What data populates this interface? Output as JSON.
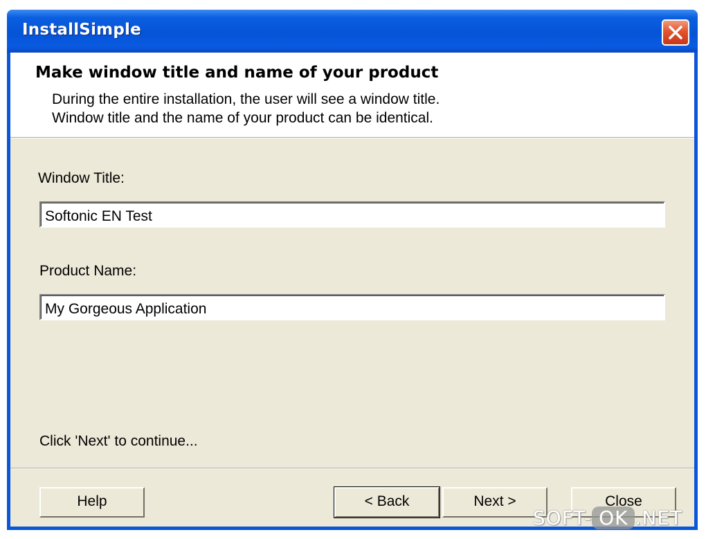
{
  "window": {
    "title": "InstallSimple",
    "close_icon": "close-x-icon"
  },
  "header": {
    "title": "Make window title and name of your product",
    "desc_line1": "During the entire installation, the user will see a window title.",
    "desc_line2": "Window title and the name of your product can be identical."
  },
  "form": {
    "window_title_label": "Window Title:",
    "window_title_value": "Softonic EN Test",
    "product_name_label": "Product Name:",
    "product_name_value": "My Gorgeous Application"
  },
  "hint": "Click 'Next' to continue...",
  "buttons": {
    "help": "Help",
    "back": "< Back",
    "next": "Next >",
    "close": "Close"
  },
  "watermark": {
    "left": "SOFT-",
    "pill": "OK",
    "right": ".NET"
  },
  "colors": {
    "titlebar": "#0553d6",
    "close_button": "#e2542e",
    "dialog_background": "#ece9d8",
    "header_background": "#ffffff"
  }
}
